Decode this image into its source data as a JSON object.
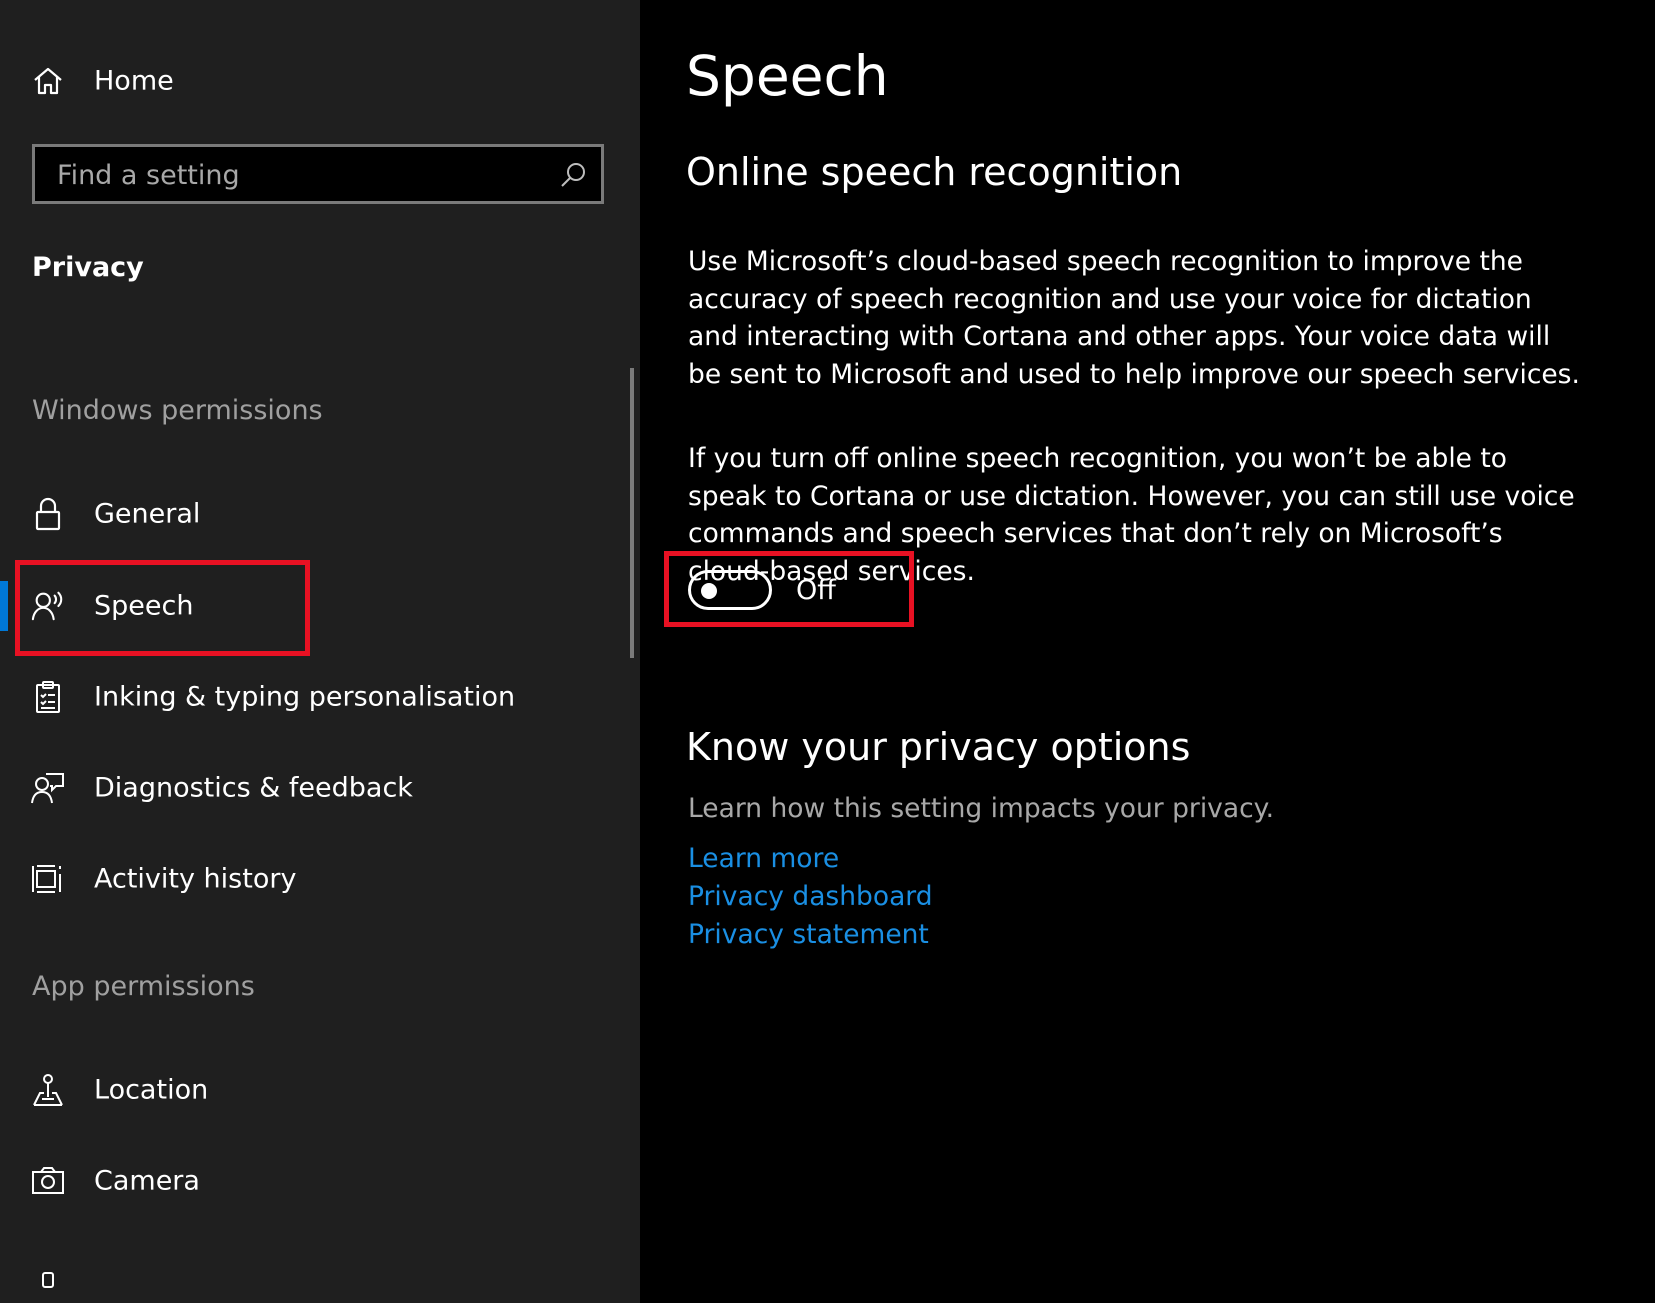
{
  "sidebar": {
    "home_label": "Home",
    "search": {
      "placeholder": "Find a setting"
    },
    "section_title": "Privacy",
    "windows_permissions_header": "Windows permissions",
    "app_permissions_header": "App permissions",
    "windows_items": [
      {
        "label": "General",
        "icon": "lock-icon"
      },
      {
        "label": "Speech",
        "icon": "speech-icon",
        "selected": true
      },
      {
        "label": "Inking & typing personalisation",
        "icon": "clipboard-checklist-icon"
      },
      {
        "label": "Diagnostics & feedback",
        "icon": "feedback-person-icon"
      },
      {
        "label": "Activity history",
        "icon": "activity-history-icon"
      }
    ],
    "app_items": [
      {
        "label": "Location",
        "icon": "location-icon"
      },
      {
        "label": "Camera",
        "icon": "camera-icon"
      }
    ]
  },
  "main": {
    "title": "Speech",
    "online_section": {
      "heading": "Online speech recognition",
      "paragraph1": "Use Microsoft’s cloud-based speech recognition to improve the accuracy of speech recognition and use your voice for dictation and interacting with Cortana and other apps. Your voice data will be sent to Microsoft and used to help improve our speech services.",
      "paragraph2": "If you turn off online speech recognition, you won’t be able to speak to Cortana or use dictation. However, you can still use voice commands and speech services that don’t rely on Microsoft’s cloud-based services.",
      "toggle_state": "Off"
    },
    "privacy_section": {
      "heading": "Know your privacy options",
      "description": "Learn how this setting impacts your privacy.",
      "links": [
        "Learn more",
        "Privacy dashboard",
        "Privacy statement"
      ]
    }
  },
  "colors": {
    "sidebar_bg": "#1f1f1f",
    "main_bg": "#000000",
    "accent": "#0078d7",
    "link": "#1a8fe3",
    "highlight": "#e81123"
  }
}
